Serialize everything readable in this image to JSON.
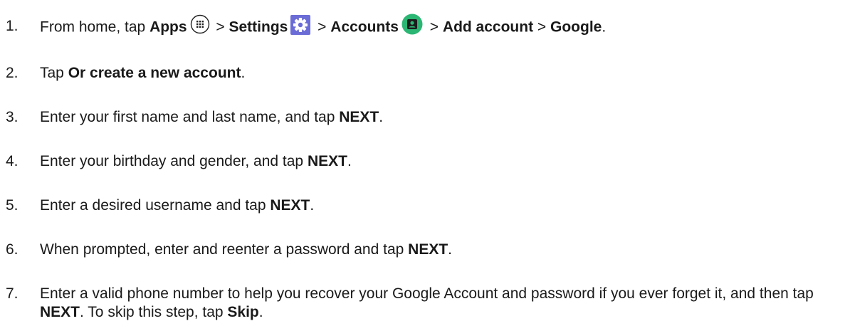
{
  "steps": [
    {
      "num": "1.",
      "s1_pre": "From home, tap ",
      "s1_apps": "Apps",
      "sep": " > ",
      "s1_settings": "Settings",
      "s1_accounts": "Accounts",
      "s1_add": "Add account",
      "s1_google": "Google",
      "end": "."
    },
    {
      "num": "2.",
      "pre": "Tap ",
      "bold": "Or create a new account",
      "post": "."
    },
    {
      "num": "3.",
      "pre": "Enter your first name and last name, and tap ",
      "bold": "NEXT",
      "post": "."
    },
    {
      "num": "4.",
      "pre": "Enter your birthday and gender, and tap ",
      "bold": "NEXT",
      "post": "."
    },
    {
      "num": "5.",
      "pre": "Enter a desired username and tap ",
      "bold": "NEXT",
      "post": "."
    },
    {
      "num": "6.",
      "pre": "When prompted, enter and reenter a password and tap ",
      "bold": "NEXT",
      "post": "."
    },
    {
      "num": "7.",
      "pre": "Enter a valid phone number to help you recover your Google Account and password if you ever forget it, and then tap ",
      "bold": "NEXT",
      "mid": ". To skip this step, tap ",
      "bold2": "Skip",
      "post": "."
    }
  ],
  "icons": {
    "apps": "apps-grid-icon",
    "settings": "settings-gear-icon",
    "accounts": "accounts-icon"
  },
  "colors": {
    "text": "#1a1a1a",
    "settings_tile": "#6b6cd6",
    "accounts_circle": "#2bb673"
  }
}
